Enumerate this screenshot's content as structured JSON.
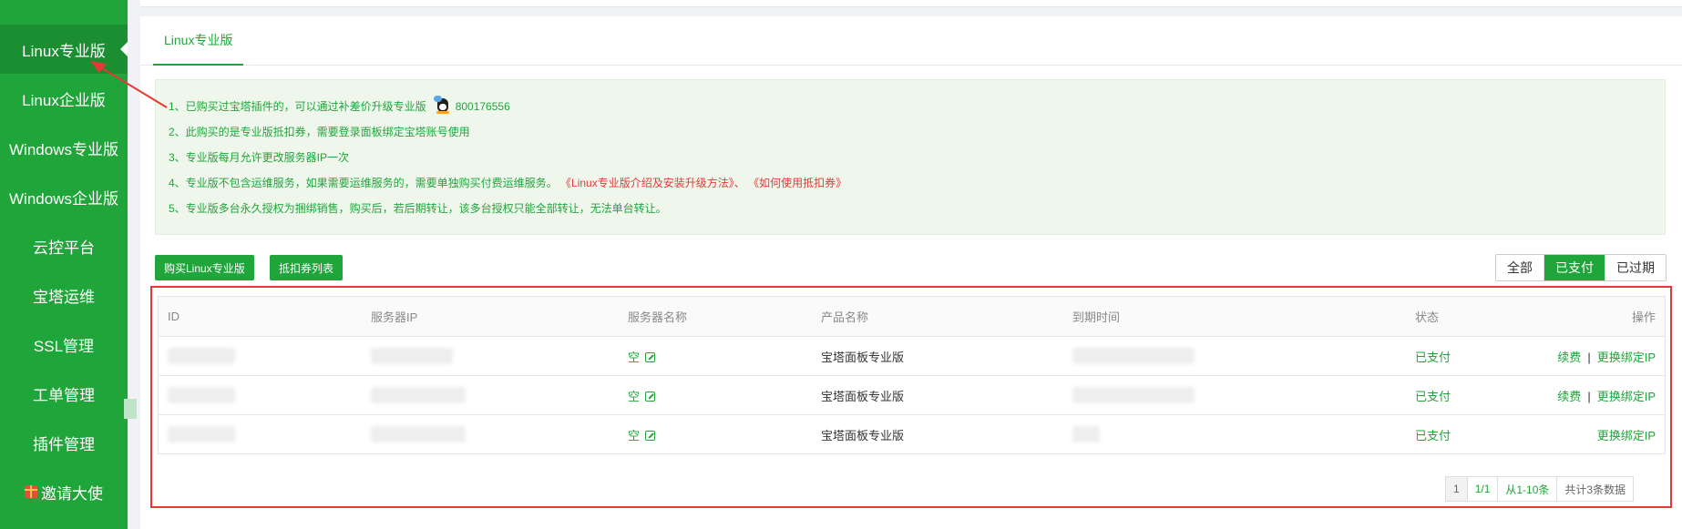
{
  "sidebar": {
    "items": [
      {
        "label": "Linux专业版"
      },
      {
        "label": "Linux企业版"
      },
      {
        "label": "Windows专业版"
      },
      {
        "label": "Windows企业版"
      },
      {
        "label": "云控平台"
      },
      {
        "label": "宝塔运维"
      },
      {
        "label": "SSL管理"
      },
      {
        "label": "工单管理"
      },
      {
        "label": "插件管理"
      },
      {
        "label": "邀请大使"
      }
    ]
  },
  "tab": {
    "label": "Linux专业版"
  },
  "notice": {
    "line1": "1、已购买过宝塔插件的，可以通过补差价升级专业版",
    "qq": "800176556",
    "line2": "2、此购买的是专业版抵扣券，需要登录面板绑定宝塔账号使用",
    "line3": "3、专业版每月允许更改服务器IP一次",
    "line4": "4、专业版不包含运维服务，如果需要运维服务的，需要单独购买付费运维服务。",
    "link1": "《Linux专业版介绍及安装升级方法》",
    "link_sep": "、",
    "link2": "《如何使用抵扣券》",
    "line5": "5、专业版多台永久授权为捆绑销售，购买后，若后期转让，该多台授权只能全部转让，无法单台转让。"
  },
  "buttons": {
    "buy": "购买Linux专业版",
    "coupons": "抵扣券列表"
  },
  "filters": [
    "全部",
    "已支付",
    "已过期"
  ],
  "table": {
    "headers": [
      "ID",
      "服务器IP",
      "服务器名称",
      "产品名称",
      "到期时间",
      "状态",
      "操作"
    ],
    "rows": [
      {
        "name": "空",
        "product": "宝塔面板专业版",
        "status": "已支付",
        "renew": "续费",
        "sep": "|",
        "change": "更换绑定IP"
      },
      {
        "name": "空",
        "product": "宝塔面板专业版",
        "status": "已支付",
        "renew": "续费",
        "sep": "|",
        "change": "更换绑定IP"
      },
      {
        "name": "空",
        "product": "宝塔面板专业版",
        "status": "已支付",
        "change": "更换绑定IP"
      }
    ]
  },
  "pager": {
    "current": "1",
    "pages": "1/1",
    "range": "从1-10条",
    "total": "共计3条数据"
  },
  "colors": {
    "brand": "#20a53a",
    "highlight": "#e53935"
  }
}
